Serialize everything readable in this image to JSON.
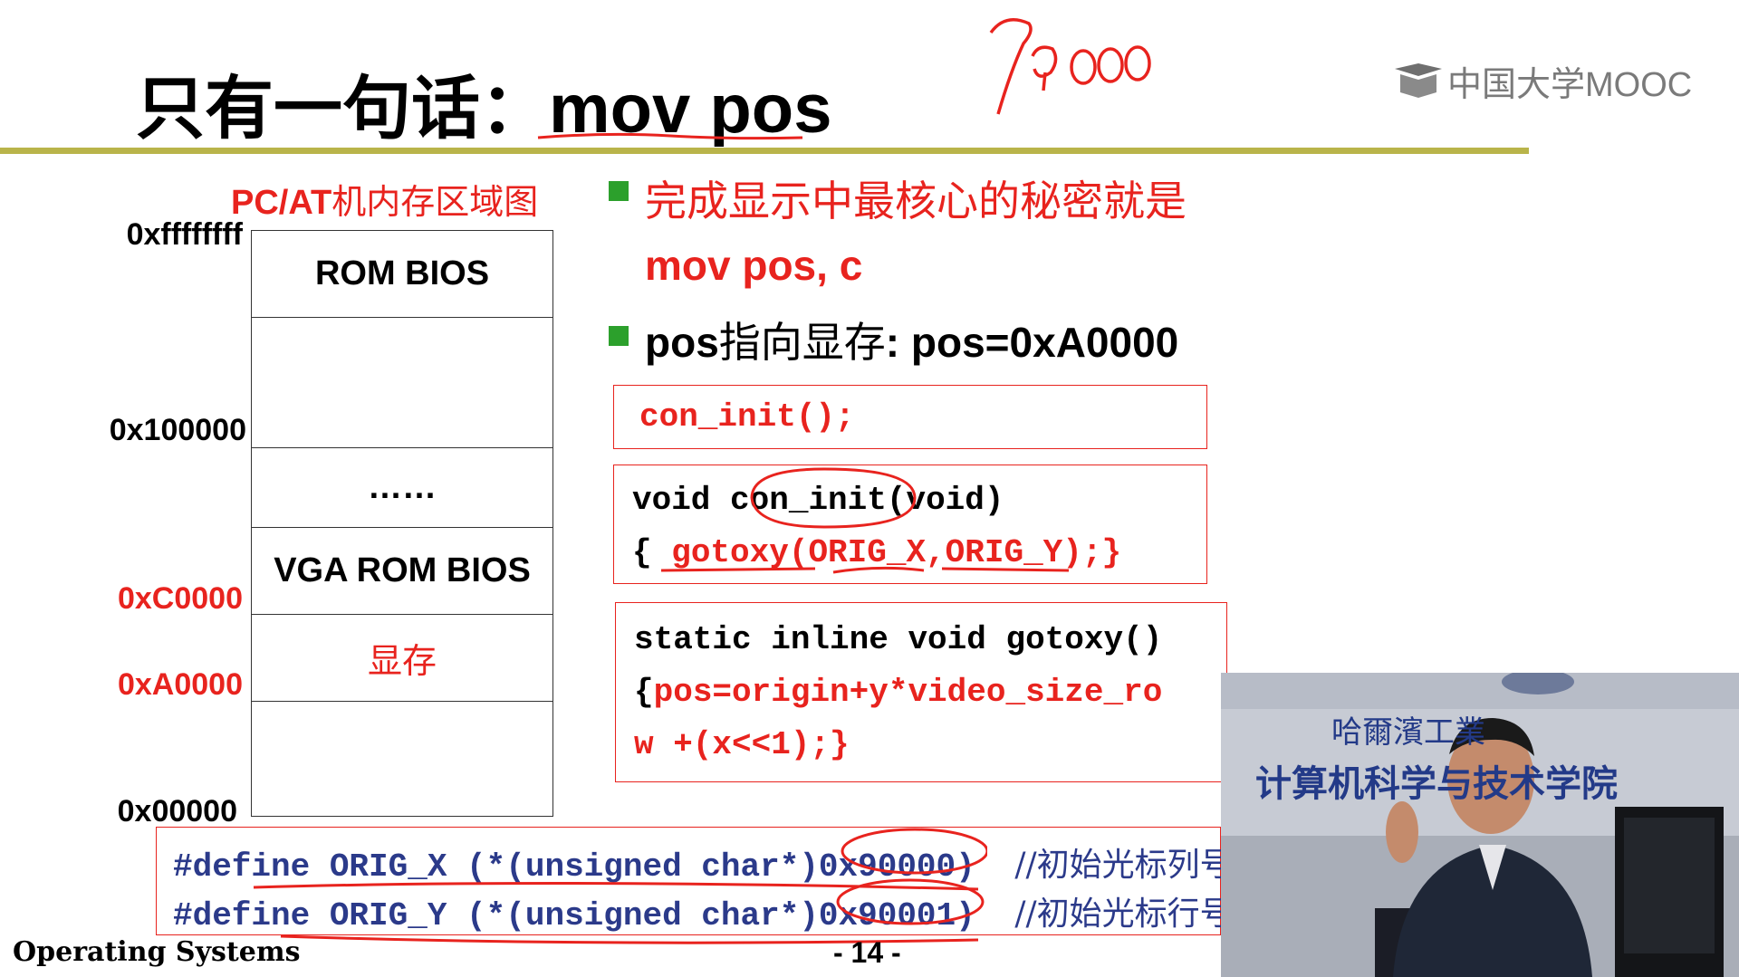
{
  "slide": {
    "title_cn": "只有一句话：",
    "title_code": "mov pos",
    "annotation_handwritten": "70000",
    "logo_text": "中国大学MOOC"
  },
  "memory_map": {
    "title_prefix": "PC/AT",
    "title_cn": "机内存区域图",
    "addresses": {
      "top": "0xffffffff",
      "a100000": "0x100000",
      "aC0000": "0xC0000",
      "aA0000": "0xA0000",
      "a00000": "0x00000"
    },
    "cells": {
      "rom_bios": "ROM BIOS",
      "blank1": "",
      "dots": "……",
      "vga_rom_bios": "VGA ROM BIOS",
      "vram": "显存",
      "blank2": ""
    }
  },
  "bullets": {
    "b1_line1": "完成显示中最核心的秘密就是",
    "b1_line2": "mov pos, c",
    "b2_prefix": "pos",
    "b2_cn": "指向显存",
    "b2_suffix": ": pos=0xA0000"
  },
  "code": {
    "box1": "con_init();",
    "box2_l1_a": "void ",
    "box2_l1_b": "con_init",
    "box2_l1_c": "(void)",
    "box2_l2_a": "{ ",
    "box2_l2_b": "gotoxy(ORIG_X,ORIG_Y);}",
    "box3_l1": "static inline void gotoxy()",
    "box3_l2_a": "{",
    "box3_l2_b": "pos=origin+y*video_size_ro",
    "box3_l3": "w +(x<<1);}",
    "define1": "#define ORIG_X (*(unsigned char*)0x90000)",
    "define1_comment": "//初始光标列号",
    "define2": "#define ORIG_Y (*(unsigned char*)0x90001)",
    "define2_comment": "//初始光标行号"
  },
  "footer": {
    "course": "Operating Systems",
    "page": "- 14 -"
  },
  "video": {
    "sign_line1": "哈爾濱工業",
    "sign_line2": "计算机科学与技术学院"
  },
  "colors": {
    "red": "#e8231e",
    "green_bullet": "#2ca02c",
    "rule_olive": "#b9b44a",
    "code_blue": "#2b3a8a"
  }
}
